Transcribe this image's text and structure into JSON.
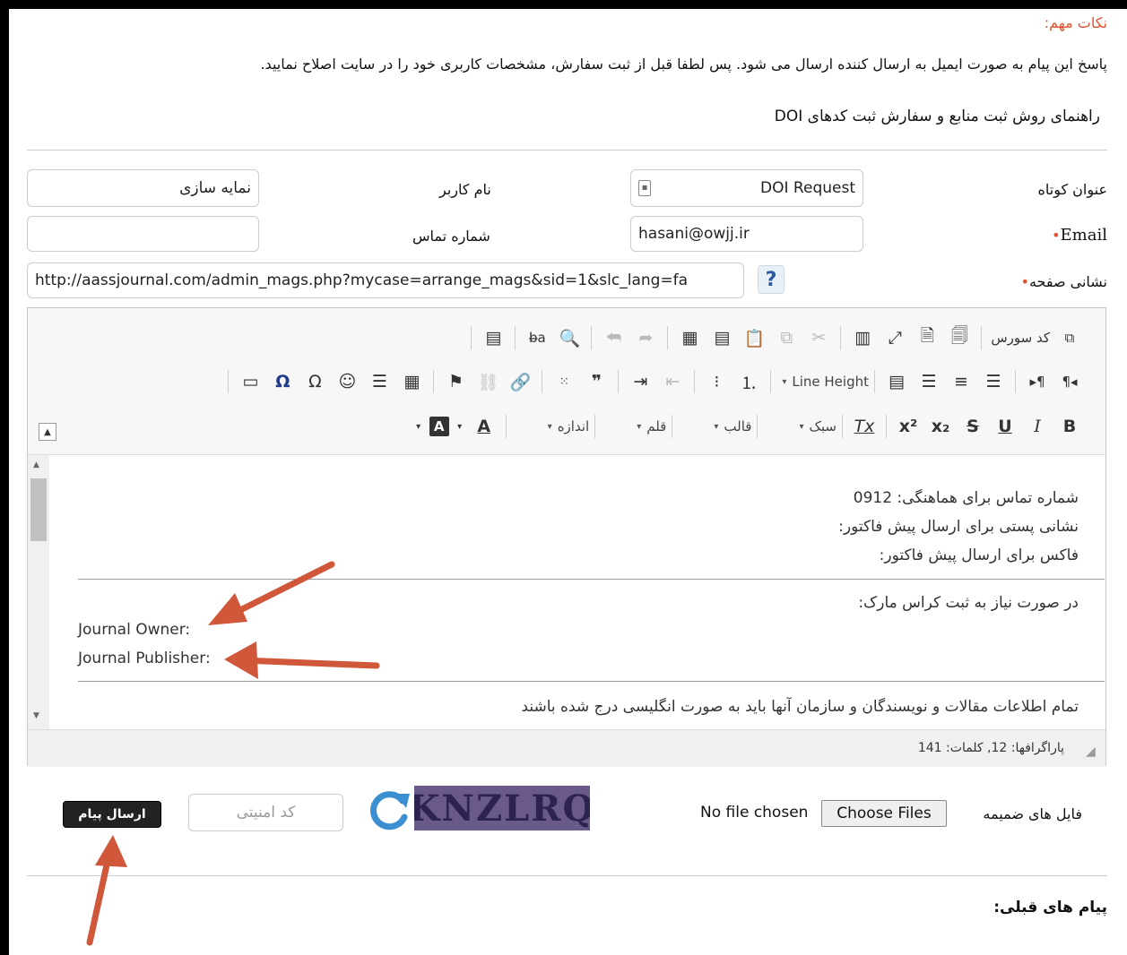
{
  "notes": {
    "title": "نکات مهم:",
    "text": "پاسخ این پیام به صورت ایمیل به ارسال کننده ارسال می شود. پس لطفا قبل از ثبت سفارش، مشخصات کاربری خود را در سایت اصلاح نمایید.",
    "guide_link": "راهنمای روش ثبت منابع و سفارش ثبت کدهای DOI"
  },
  "form": {
    "subject_label": "عنوان کوتاه",
    "subject_value": "DOI Request",
    "username_label": "نام کاربر",
    "username_value": "نمایه سازی",
    "email_label": "Email",
    "email_value": "hasani@owjj.ir",
    "phone_label": "شماره تماس",
    "phone_value": "",
    "url_label": "نشانی صفحه",
    "url_value": "http://aassjournal.com/admin_mags.php?mycase=arrange_mags&sid=1&slc_lang=fa",
    "help_icon": "?"
  },
  "toolbar": {
    "source_label": "کد سورس",
    "line_height_label": "Line Height",
    "style_label": "سبک",
    "format_label": "قالب",
    "font_label": "قلم",
    "size_label": "اندازه",
    "text_color_label": "A",
    "bg_color_label": "A",
    "bold": "B",
    "italic": "I",
    "underline": "U",
    "strike": "S",
    "subscript": "x₂",
    "superscript": "x²",
    "remove_format": "Tx"
  },
  "editor": {
    "line1": "شماره تماس برای هماهنگی: 0912",
    "line2": "نشانی پستی برای ارسال پیش فاکتور:",
    "line3": "فاکس برای ارسال پیش فاکتور:",
    "line4": "در صورت نیاز به ثبت کراس مارک:",
    "line5": "Journal Owner:",
    "line6": "Journal Publisher:",
    "line7": "تمام اطلاعات مقالات و نویسندگان و سازمان آنها باید به صورت انگلیسی درج شده باشند",
    "status": "پاراگرافها: 12, کلمات: 141"
  },
  "footer": {
    "attachments_label": "فایل های ضمیمه",
    "choose_files": "Choose Files",
    "no_file": "No file chosen",
    "captcha_text": "KNZLRQ",
    "captcha_placeholder": "کد امنیتی",
    "send_button": "ارسال پیام",
    "previous_messages": "پیام های قبلی:"
  },
  "colors": {
    "required": "#e0522c",
    "arrow": "#d0573a",
    "captcha_bg": "#6a5a8a",
    "refresh": "#3a8fd0"
  }
}
